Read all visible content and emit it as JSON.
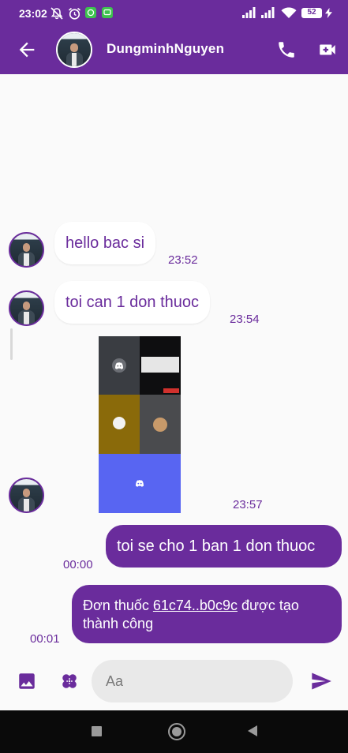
{
  "status_bar": {
    "time": "23:02",
    "battery": "52"
  },
  "header": {
    "contact_name": "DungminhNguyen"
  },
  "messages": [
    {
      "direction": "incoming",
      "text": "hello bac si",
      "time": "23:52"
    },
    {
      "direction": "incoming",
      "text": "toi can 1 don thuoc",
      "time": "23:54"
    },
    {
      "direction": "incoming",
      "type": "image",
      "time": "23:57"
    },
    {
      "direction": "outgoing",
      "text": "toi se cho 1 ban 1 don thuoc",
      "time": "00:00"
    },
    {
      "direction": "outgoing",
      "text_prefix": "Đơn thuốc",
      "link": "61c74..b0c9c",
      "text_suffix_line1": "được tạo",
      "text_line2": "thành công",
      "time": "00:01"
    }
  ],
  "input": {
    "placeholder": "Aa"
  },
  "colors": {
    "primary": "#6a2c9c",
    "incoming_bubble": "#ffffff",
    "input_bg": "#e9e9e9"
  },
  "icons": [
    "back-arrow-icon",
    "phone-icon",
    "video-camera-icon",
    "image-icon",
    "pill-icon",
    "send-icon"
  ]
}
